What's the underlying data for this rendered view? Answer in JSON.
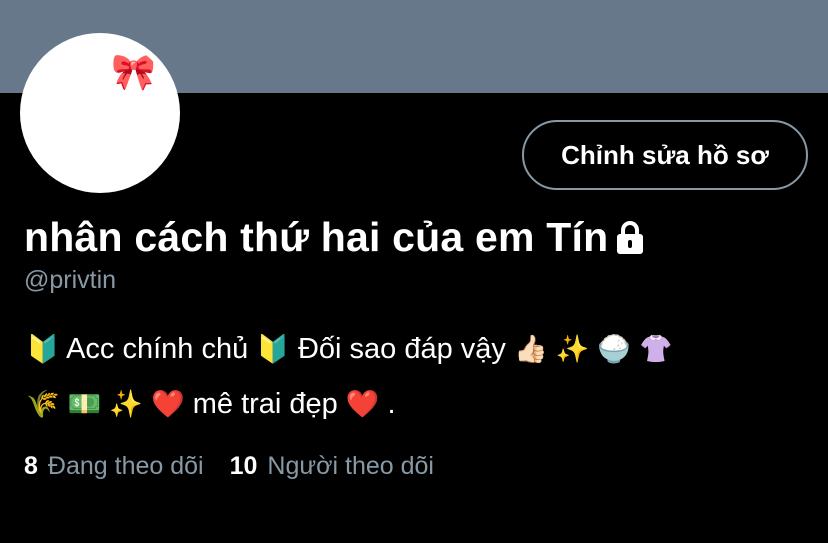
{
  "colors": {
    "banner": "#66788a",
    "background": "#000000",
    "secondary_text": "#8899a6",
    "button_border": "#8899a6"
  },
  "avatar": {
    "emoji": "😌",
    "accessory": "🎀"
  },
  "edit_button": {
    "label": "Chỉnh sửa hồ sơ"
  },
  "profile": {
    "display_name": "nhân cách thứ hai của em Tín",
    "handle": "@privtin",
    "protected_icon": "lock-icon"
  },
  "bio": {
    "line1": [
      {
        "t": "🔰",
        "emoji": true
      },
      {
        "t": "  Acc chính chủ "
      },
      {
        "t": "🔰",
        "emoji": true
      },
      {
        "t": " Đối sao đáp vậy "
      },
      {
        "t": "👍🏻",
        "emoji": true
      },
      {
        "t": " "
      },
      {
        "t": "✨",
        "emoji": true
      },
      {
        "t": "  "
      },
      {
        "t": "🍚",
        "emoji": true
      },
      {
        "t": "  "
      },
      {
        "t": "👚",
        "emoji": true
      }
    ],
    "line2": [
      {
        "t": "🌾",
        "emoji": true
      },
      {
        "t": "  "
      },
      {
        "t": "💵",
        "emoji": true
      },
      {
        "t": "  "
      },
      {
        "t": "✨",
        "emoji": true
      },
      {
        "t": "  "
      },
      {
        "t": "❤️",
        "emoji": true
      },
      {
        "t": "  mê trai đẹp "
      },
      {
        "t": "❤️",
        "emoji": true
      },
      {
        "t": "  ."
      }
    ]
  },
  "stats": {
    "following": {
      "count": "8",
      "label": "Đang theo dõi"
    },
    "followers": {
      "count": "10",
      "label": "Người theo dõi"
    }
  }
}
